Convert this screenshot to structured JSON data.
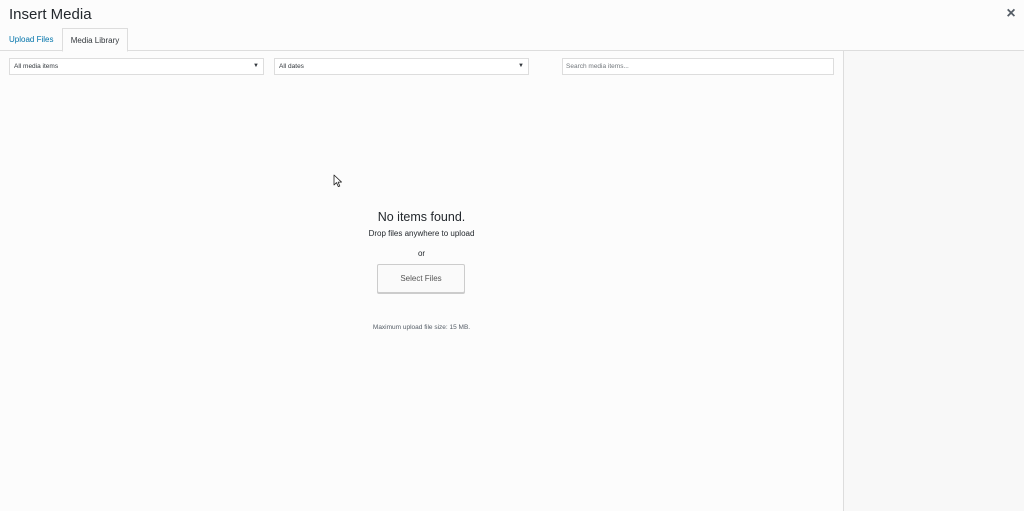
{
  "modal": {
    "title": "Insert Media",
    "close_symbol": "×"
  },
  "tabs": [
    {
      "label": "Upload Files",
      "active": false
    },
    {
      "label": "Media Library",
      "active": true
    }
  ],
  "toolbar": {
    "type_filter": {
      "selected": "All media items",
      "arrow": "▼"
    },
    "date_filter": {
      "selected": "All dates",
      "arrow": "▼"
    },
    "search": {
      "placeholder": "Search media items...",
      "value": ""
    }
  },
  "empty_state": {
    "title": "No items found.",
    "subtitle": "Drop files anywhere to upload",
    "or_text": "or",
    "button_label": "Select Files",
    "max_upload": "Maximum upload file size: 15 MB."
  },
  "colors": {
    "link": "#0073aa",
    "background": "#fcfcfc",
    "border": "#dddddd"
  },
  "icons": {
    "close": "close-icon",
    "dropdown": "chevron-down-icon",
    "pointer": "cursor-icon"
  }
}
